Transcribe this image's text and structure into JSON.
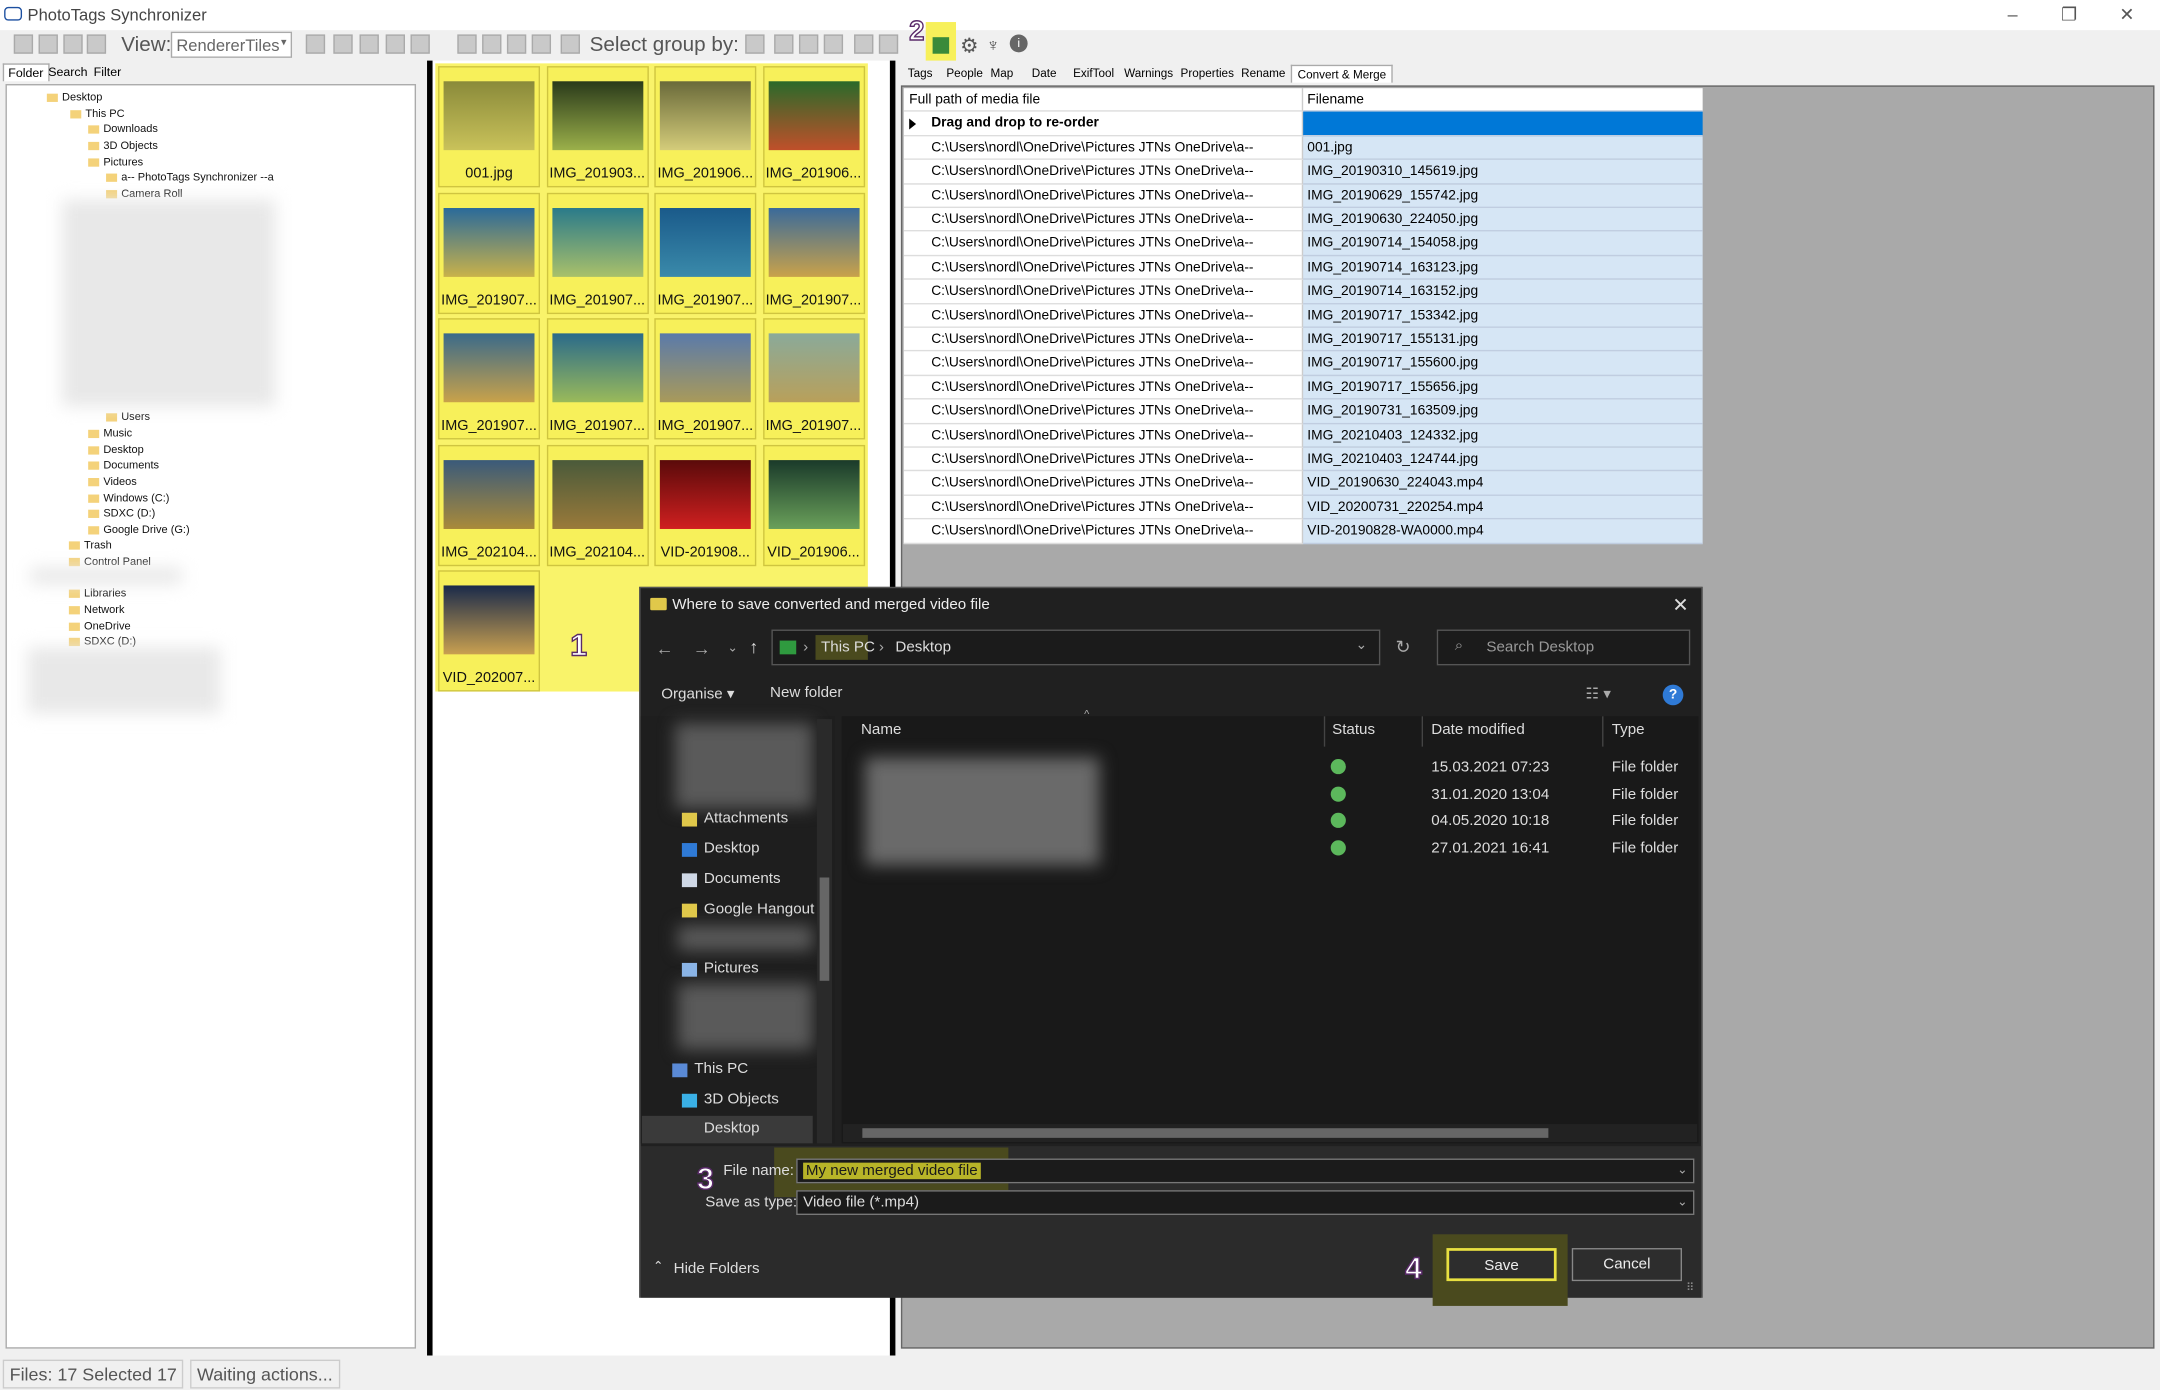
{
  "window": {
    "title": "PhotoTags Synchronizer",
    "min": "–",
    "max": "❐",
    "close": "✕"
  },
  "toolbar": {
    "view_label": "View:",
    "view_value": "RendererTiles",
    "group_label": "Select group by:"
  },
  "left_tabs": [
    "Folder",
    "Search",
    "Filter"
  ],
  "tree": [
    "Desktop",
    "This PC",
    "Downloads",
    "3D Objects",
    "Pictures",
    "a-- PhotoTags Synchronizer --a",
    "Camera Roll",
    "Users",
    "Music",
    "Desktop",
    "Documents",
    "Videos",
    "Windows (C:)",
    "SDXC (D:)",
    "Google Drive (G:)",
    "Trash",
    "Control Panel",
    "Libraries",
    "Network",
    "OneDrive",
    "SDXC (D:)"
  ],
  "thumbs": [
    "001.jpg",
    "IMG_201903...",
    "IMG_201906...",
    "IMG_201906...",
    "IMG_201907...",
    "IMG_201907...",
    "IMG_201907...",
    "IMG_201907...",
    "IMG_201907...",
    "IMG_201907...",
    "IMG_201907...",
    "IMG_201907...",
    "IMG_202104...",
    "IMG_202104...",
    "VID-201908...",
    "VID_201906...",
    "VID_202007..."
  ],
  "callouts": [
    "1",
    "2",
    "3",
    "4"
  ],
  "right_tabs": [
    "Tags",
    "People",
    "Map",
    "Date",
    "ExifTool",
    "Warnings",
    "Properties",
    "Rename",
    "Convert & Merge"
  ],
  "grid": {
    "headers": [
      "Full path of media file",
      "Filename"
    ],
    "first_row": "Drag and drop to re-order",
    "path": "C:\\Users\\nordl\\OneDrive\\Pictures JTNs OneDrive\\a--",
    "files": [
      "001.jpg",
      "IMG_20190310_145619.jpg",
      "IMG_20190629_155742.jpg",
      "IMG_20190630_224050.jpg",
      "IMG_20190714_154058.jpg",
      "IMG_20190714_163123.jpg",
      "IMG_20190714_163152.jpg",
      "IMG_20190717_153342.jpg",
      "IMG_20190717_155131.jpg",
      "IMG_20190717_155600.jpg",
      "IMG_20190717_155656.jpg",
      "IMG_20190731_163509.jpg",
      "IMG_20210403_124332.jpg",
      "IMG_20210403_124744.jpg",
      "VID_20190630_224043.mp4",
      "VID_20200731_220254.mp4",
      "VID-20190828-WA0000.mp4"
    ]
  },
  "dialog": {
    "title": "Where to save converted and merged video file",
    "crumb_root": "This PC",
    "crumb_current": "Desktop",
    "search_placeholder": "Search Desktop",
    "organise": "Organise ▾",
    "new_folder": "New folder",
    "side": [
      "Attachments",
      "Desktop",
      "Documents",
      "Google Hangout",
      "Pictures",
      "This PC",
      "3D Objects",
      "Desktop"
    ],
    "columns": [
      "Name",
      "Status",
      "Date modified",
      "Type"
    ],
    "rows": [
      {
        "date": "15.03.2021 07:23",
        "type": "File folder"
      },
      {
        "date": "31.01.2020 13:04",
        "type": "File folder"
      },
      {
        "date": "04.05.2020 10:18",
        "type": "File folder"
      },
      {
        "date": "27.01.2021 16:41",
        "type": "File folder"
      }
    ],
    "file_name_label": "File name:",
    "file_name_value": "My new merged video file",
    "save_type_label": "Save as type:",
    "save_type_value": "Video file (*.mp4)",
    "hide_folders": "Hide Folders",
    "save": "Save",
    "cancel": "Cancel"
  },
  "status": {
    "files": "Files: 17 Selected 17",
    "action": "Waiting actions..."
  }
}
